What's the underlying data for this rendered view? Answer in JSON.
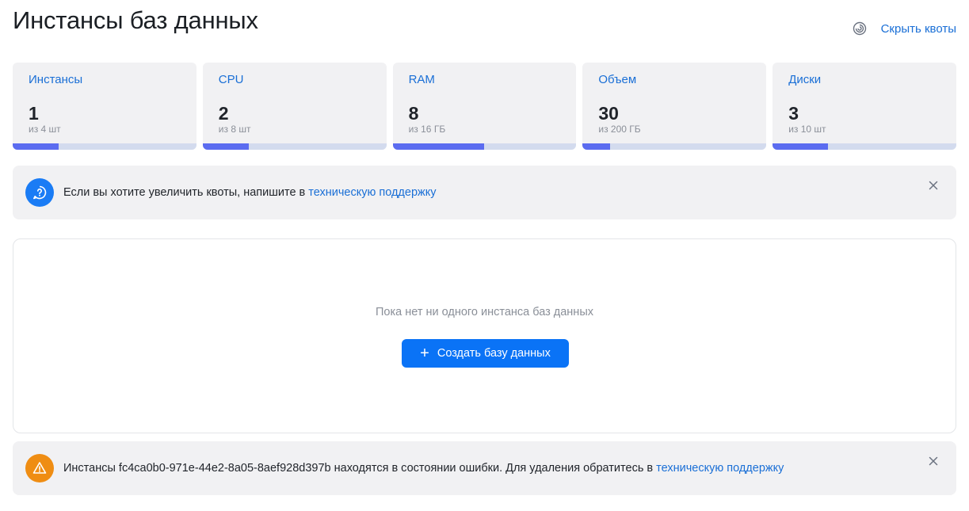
{
  "header": {
    "title": "Инстансы баз данных",
    "hide_quotas_label": "Скрыть квоты"
  },
  "quotas": [
    {
      "title": "Инстансы",
      "value": "1",
      "sub": "из 4 шт",
      "fraction": 0.25
    },
    {
      "title": "CPU",
      "value": "2",
      "sub": "из 8 шт",
      "fraction": 0.25
    },
    {
      "title": "RAM",
      "value": "8",
      "sub": "из 16 ГБ",
      "fraction": 0.5
    },
    {
      "title": "Объем",
      "value": "30",
      "sub": "из 200 ГБ",
      "fraction": 0.15
    },
    {
      "title": "Диски",
      "value": "3",
      "sub": "из 10 шт",
      "fraction": 0.3
    }
  ],
  "info_notice": {
    "icon": "question-chat-icon",
    "text": "Если вы хотите увеличить квоты, напишите в ",
    "link": "техническую поддержку"
  },
  "empty_state": {
    "text": "Пока нет ни одного инстанса баз данных",
    "create_button": "Создать базу данных"
  },
  "error_notice": {
    "icon": "warning-icon",
    "text": "Инстансы fc4ca0b0-971e-44e2-8a05-8aef928d397b находятся в состоянии ошибки. Для удаления обратитесь в ",
    "link": "техническую поддержку"
  },
  "colors": {
    "accent": "#0a73f6",
    "link": "#1a6fd6",
    "progress_fill": "#5b6cf0",
    "progress_track": "#d3dbee",
    "warning": "#ef8d13"
  }
}
